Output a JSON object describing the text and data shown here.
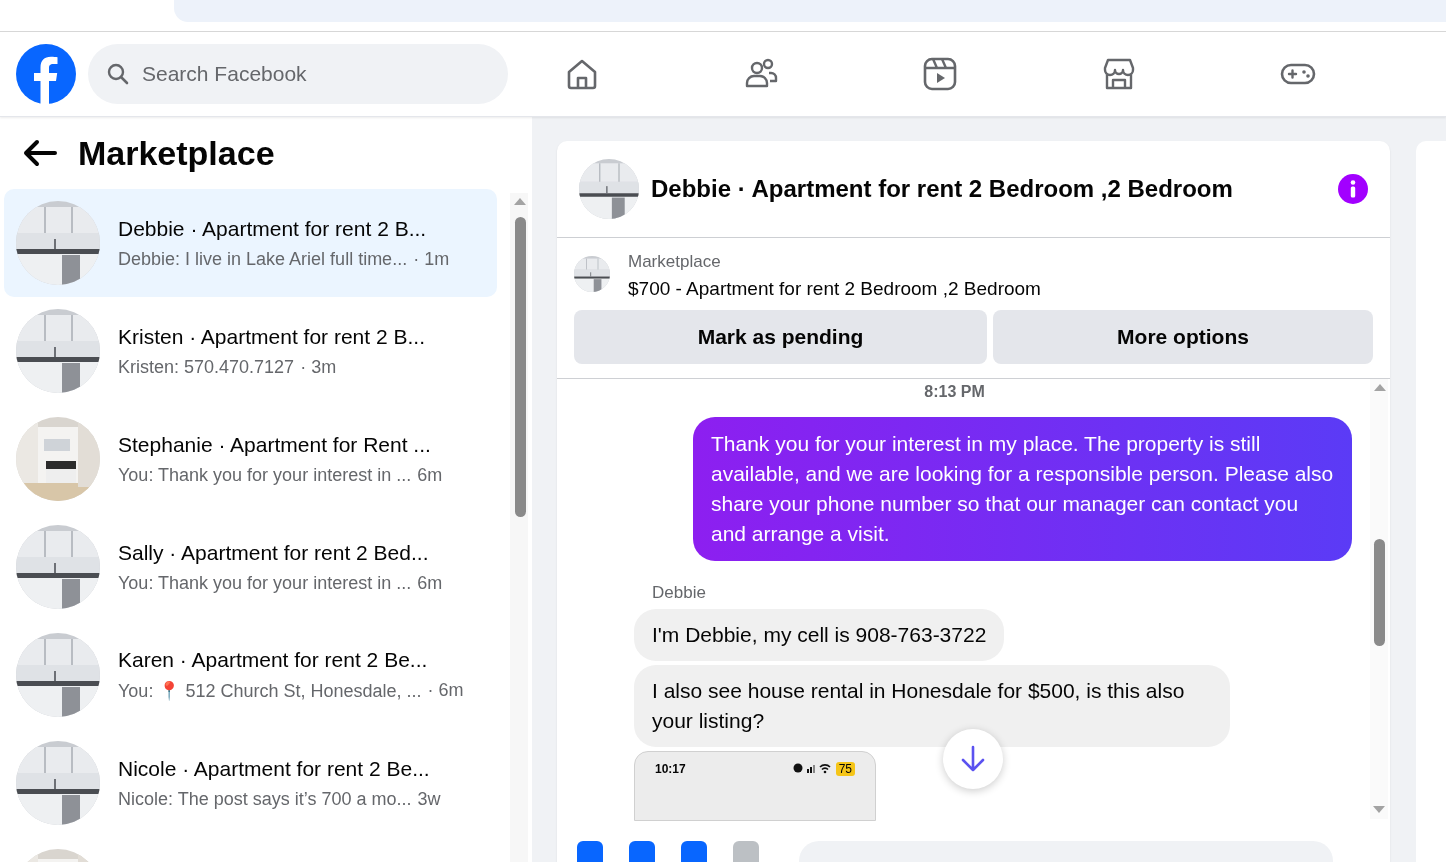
{
  "search": {
    "placeholder": "Search Facebook"
  },
  "nav": [
    {
      "kind": "home"
    },
    {
      "kind": "friends"
    },
    {
      "kind": "video"
    },
    {
      "kind": "store"
    },
    {
      "kind": "gaming"
    }
  ],
  "sidebar": {
    "title": "Marketplace",
    "conversations": [
      {
        "title": "Debbie · Apartment for rent 2 B...",
        "preview": "Debbie: I live in Lake Ariel full time...",
        "time": "· 1m",
        "selected": true,
        "kind": "kitchen"
      },
      {
        "title": "Kristen · Apartment for rent 2 B...",
        "preview": "Kristen: 570.470.7127",
        "time": "· 3m",
        "selected": false,
        "kind": "kitchen"
      },
      {
        "title": "Stephanie · Apartment for Rent ...",
        "preview": "You: Thank you for your interest in ...",
        "time": "6m",
        "selected": false,
        "kind": "room"
      },
      {
        "title": "Sally · Apartment for rent 2 Bed...",
        "preview": "You: Thank you for your interest in ...",
        "time": "6m",
        "selected": false,
        "kind": "kitchen"
      },
      {
        "title": "Karen · Apartment for rent 2 Be...",
        "preview": "You: 📍 512 Church St, Honesdale, ...",
        "time": "· 6m",
        "selected": false,
        "kind": "kitchen"
      },
      {
        "title": "Nicole · Apartment for rent 2 Be...",
        "preview": "Nicole: The post says it’s 700 a mo...",
        "time": "3w",
        "selected": false,
        "kind": "kitchen"
      }
    ]
  },
  "chat": {
    "title": "Debbie · Apartment for rent 2 Bedroom ,2 Bedroom",
    "listing": {
      "source": "Marketplace",
      "name": "$700 - Apartment for rent 2 Bedroom ,2 Bedroom"
    },
    "buttons": [
      "Mark as pending",
      "More options"
    ],
    "timestamp": "8:13 PM",
    "messages": [
      {
        "kind": "outgoing",
        "text": "Thank you for your interest in my place. The property is still available, and we are looking for a responsible person. Please also share your phone number so that our manager can contact you and arrange a visit."
      },
      {
        "kind": "sender",
        "text": "Debbie"
      },
      {
        "kind": "incoming",
        "text": "I'm Debbie, my cell is 908-763-3722"
      },
      {
        "kind": "incoming",
        "text": "I also see house rental in Honesdale for $500, is this also your listing?"
      },
      {
        "kind": "screenshot",
        "time": "10:17",
        "battery": "75"
      }
    ]
  }
}
